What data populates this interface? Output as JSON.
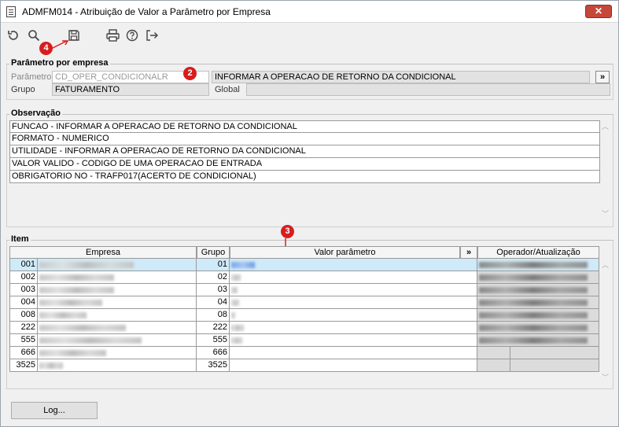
{
  "window": {
    "title": "ADMFM014 - Atribuição de Valor a Parâmetro por Empresa",
    "close_glyph": "✕"
  },
  "toolbar": {
    "badge": "4"
  },
  "param": {
    "group_title": "Parâmetro por empresa",
    "parametro_label": "Parâmetro",
    "parametro_value": "CD_OPER_CONDICIONALR",
    "badge": "2",
    "descricao_value": "INFORMAR A OPERACAO DE RETORNO DA CONDICIONAL",
    "lookup_label": "»",
    "grupo_label": "Grupo",
    "grupo_value": "FATURAMENTO",
    "global_label": "Global",
    "global_value": ""
  },
  "observacao": {
    "group_title": "Observação",
    "lines": [
      "FUNCAO -  INFORMAR A OPERACAO DE RETORNO DA CONDICIONAL",
      "FORMATO - NUMERICO",
      "UTILIDADE -  INFORMAR A OPERACAO DE RETORNO DA CONDICIONAL",
      "VALOR VALIDO - CODIGO DE UMA OPERACAO DE ENTRADA",
      "OBRIGATORIO NO - TRAFP017(ACERTO DE CONDICIONAL)"
    ]
  },
  "item": {
    "group_title": "Item",
    "badge": "3",
    "columns": {
      "empresa": "Empresa",
      "grupo": "Grupo",
      "valor": "Valor parâmetro",
      "expand": "»",
      "operador": "Operador/Atualização"
    },
    "rows": [
      {
        "code": "001",
        "grupo": "01"
      },
      {
        "code": "002",
        "grupo": "02"
      },
      {
        "code": "003",
        "grupo": "03"
      },
      {
        "code": "004",
        "grupo": "04"
      },
      {
        "code": "008",
        "grupo": "08"
      },
      {
        "code": "222",
        "grupo": "222"
      },
      {
        "code": "555",
        "grupo": "555"
      },
      {
        "code": "666",
        "grupo": "666"
      },
      {
        "code": "3525",
        "grupo": "3525"
      }
    ]
  },
  "footer": {
    "log_label": "Log..."
  }
}
